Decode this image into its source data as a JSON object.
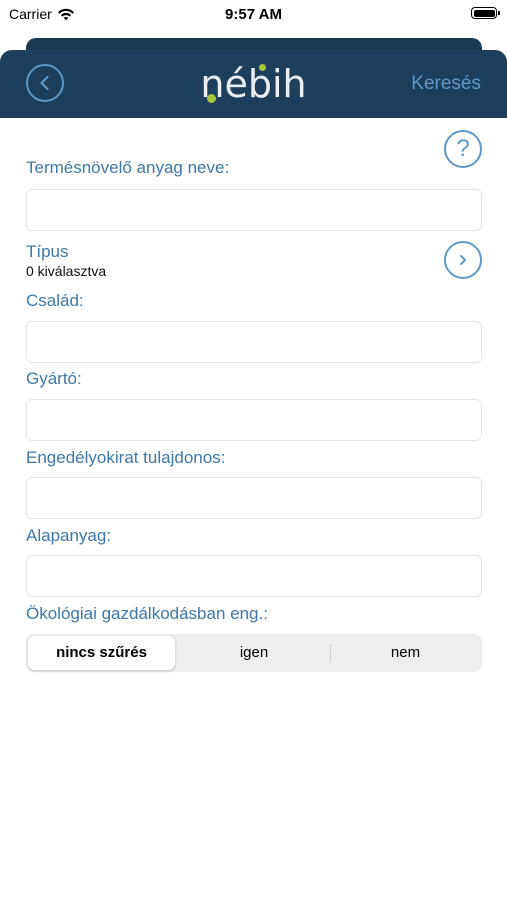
{
  "status_bar": {
    "carrier": "Carrier",
    "time": "9:57 AM"
  },
  "nav": {
    "logo": "nébih",
    "search_label": "Keresés"
  },
  "form": {
    "product_name_label": "Termésnövelő anyag neve:",
    "product_name_value": "",
    "type_label": "Típus",
    "type_selected": "0 kiválasztva",
    "family_label": "Család:",
    "family_value": "",
    "manufacturer_label": "Gyártó:",
    "manufacturer_value": "",
    "license_holder_label": "Engedélyokirat tulajdonos:",
    "license_holder_value": "",
    "raw_material_label": "Alapanyag:",
    "raw_material_value": "",
    "organic_label": "Ökológiai gazdálkodásban eng.:",
    "organic_options": [
      "nincs szűrés",
      "igen",
      "nem"
    ],
    "organic_selected": "nincs szűrés"
  },
  "colors": {
    "nav_bg": "#1d3f5c",
    "accent": "#5f98c7",
    "label": "#3d78a8",
    "logo_dot": "#a4c73a"
  },
  "icons": [
    "wifi-icon",
    "battery-icon",
    "back-chevron-icon",
    "help-icon",
    "chevron-right-icon"
  ]
}
